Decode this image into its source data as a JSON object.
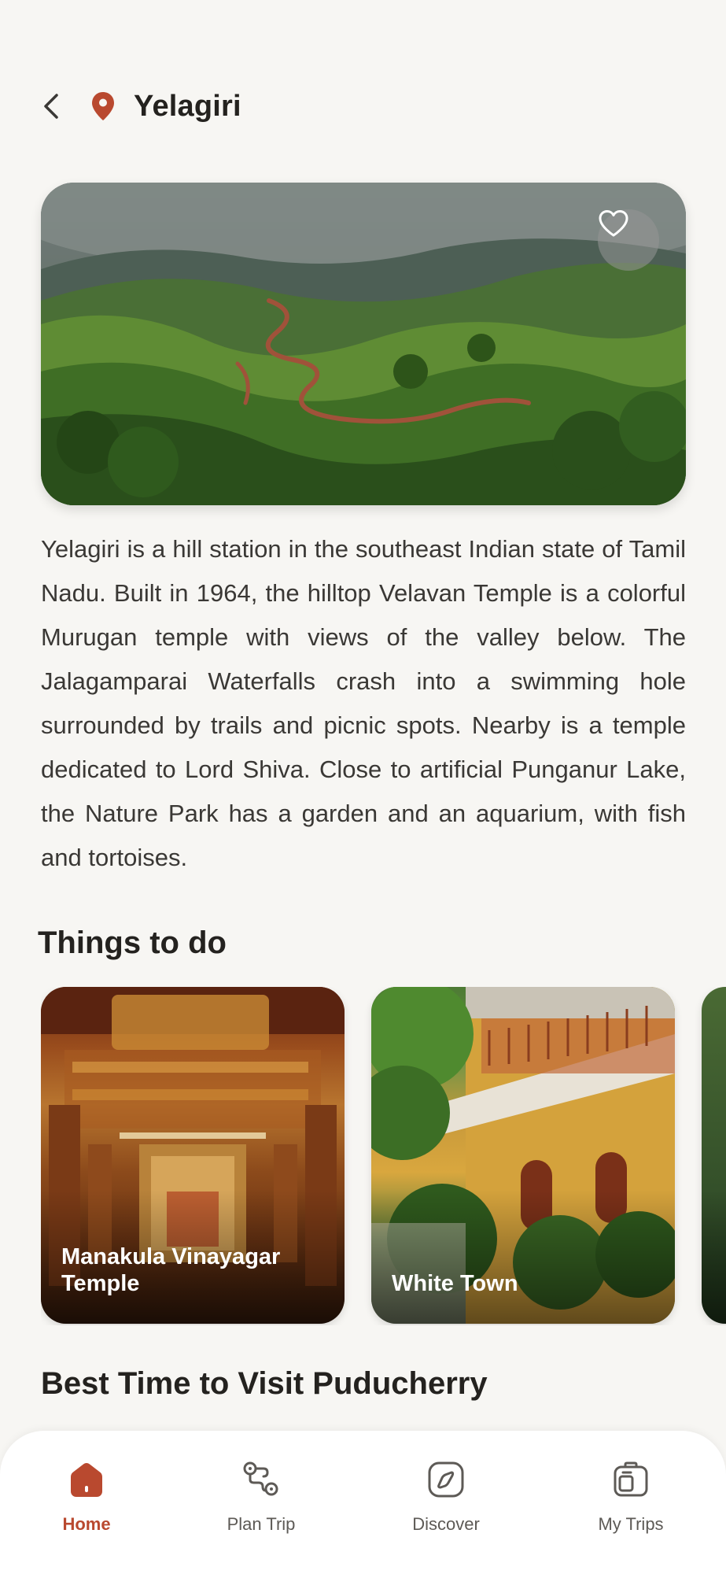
{
  "header": {
    "back_icon": "chevron-left-icon",
    "location_icon": "map-pin-icon",
    "title": "Yelagiri"
  },
  "hero": {
    "image": "misty green hills and valley with winding red dirt road",
    "favorite_icon": "heart-outline-icon"
  },
  "description": "Yelagiri is a hill station in the southeast Indian state of Tamil Nadu. Built in 1964, the hilltop Velavan Temple is a colorful Murugan temple with views of the valley below. The Jalagamparai Waterfalls crash into a swimming hole surrounded by trails and picnic spots. Nearby is a temple dedicated to Lord Shiva. Close to artificial Punganur Lake, the Nature Park has a garden and an aquarium, with fish and tortoises.",
  "things_to_do": {
    "title": "Things to do",
    "cards": [
      {
        "label": "Manakula Vinayagar Temple",
        "image": "ornate golden temple interior"
      },
      {
        "label": "White Town",
        "image": "yellow colonial building with balcony and trees"
      },
      {
        "label": "",
        "image": "palm trees (partially visible)"
      }
    ]
  },
  "best_time": {
    "title": "Best Time to Visit Puducherry"
  },
  "bottom_nav": {
    "items": [
      {
        "label": "Home",
        "icon": "home-icon",
        "active": true
      },
      {
        "label": "Plan Trip",
        "icon": "route-icon",
        "active": false
      },
      {
        "label": "Discover",
        "icon": "compass-icon",
        "active": false
      },
      {
        "label": "My Trips",
        "icon": "luggage-icon",
        "active": false
      }
    ]
  },
  "colors": {
    "accent": "#b9492f",
    "background": "#f7f6f3",
    "text": "#24221f"
  }
}
